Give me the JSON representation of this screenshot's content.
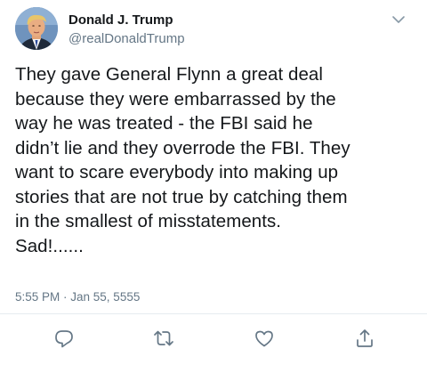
{
  "user": {
    "display_name": "Donald J. Trump",
    "handle": "@realDonaldTrump"
  },
  "tweet": {
    "text": "They gave General Flynn a great deal\nbecause they were embarrassed by the\nway he was treated - the FBI said he\ndidn’t lie and they overrode the FBI. They\nwant to scare everybody into making up\nstories that are not true by catching them\nin the smallest of misstatements.\nSad!......",
    "timestamp": "5:55 PM · Jan 55, 5555"
  },
  "icons": {
    "menu": "chevron-down-icon",
    "reply": "reply-icon",
    "retweet": "retweet-icon",
    "like": "heart-icon",
    "share": "share-icon"
  },
  "colors": {
    "text": "#14171a",
    "secondary": "#657786",
    "divider": "#e6ecf0",
    "icon": "#657786"
  }
}
